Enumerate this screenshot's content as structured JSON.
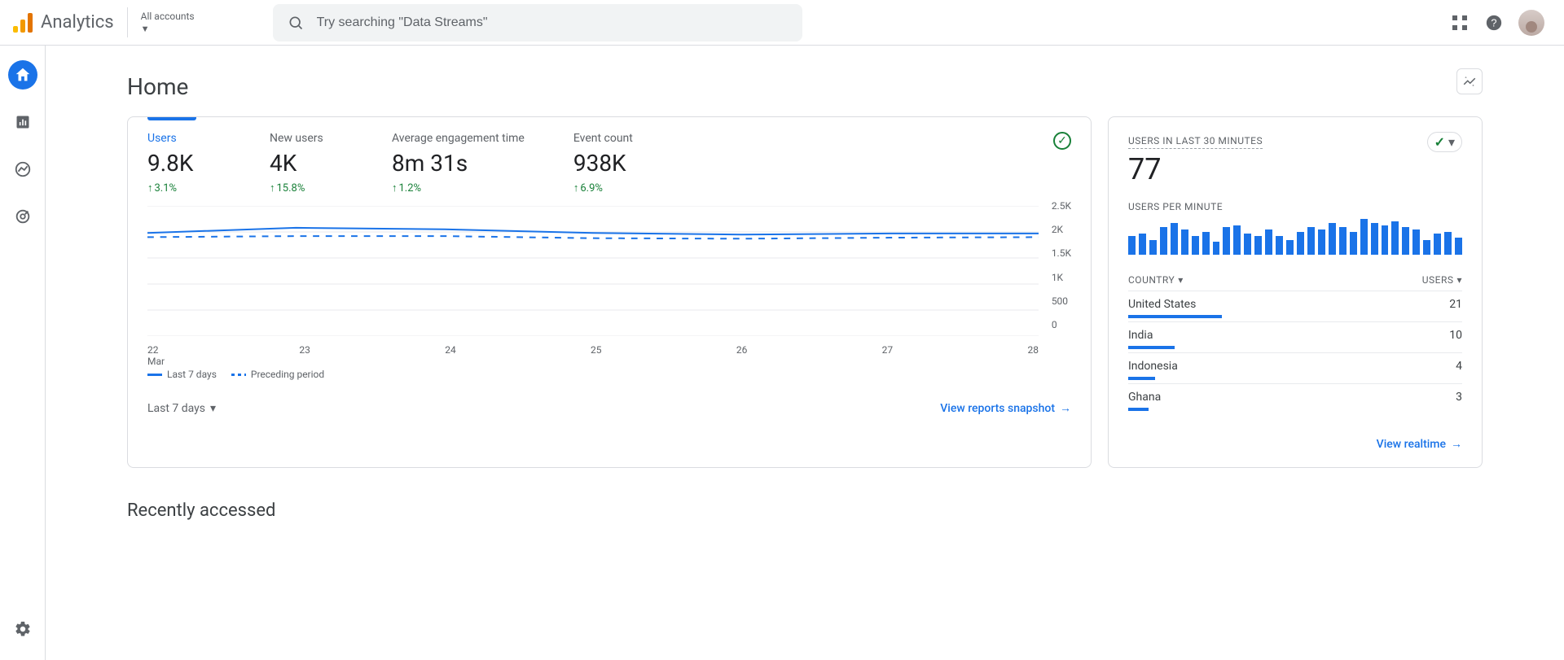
{
  "header": {
    "product_name": "Analytics",
    "account_switcher_label": "All accounts",
    "search_placeholder": "Try searching \"Data Streams\""
  },
  "page": {
    "title": "Home",
    "recently_accessed_title": "Recently accessed"
  },
  "main_card": {
    "metrics": [
      {
        "label": "Users",
        "value": "9.8K",
        "delta": "3.1%"
      },
      {
        "label": "New users",
        "value": "4K",
        "delta": "15.8%"
      },
      {
        "label": "Average engagement time",
        "value": "8m 31s",
        "delta": "1.2%"
      },
      {
        "label": "Event count",
        "value": "938K",
        "delta": "6.9%"
      }
    ],
    "y_ticks": [
      "2.5K",
      "2K",
      "1.5K",
      "1K",
      "500",
      "0"
    ],
    "x_ticks": [
      "22",
      "23",
      "24",
      "25",
      "26",
      "27",
      "28"
    ],
    "x_month": "Mar",
    "legend": {
      "current": "Last 7 days",
      "previous": "Preceding period"
    },
    "date_range_label": "Last 7 days",
    "footer_link": "View reports snapshot"
  },
  "chart_data": {
    "type": "line",
    "title": "Users",
    "xlabel": "",
    "ylabel": "",
    "ylim": [
      0,
      2500
    ],
    "categories": [
      "22",
      "23",
      "24",
      "25",
      "26",
      "27",
      "28"
    ],
    "series": [
      {
        "name": "Last 7 days",
        "values": [
          1980,
          2080,
          2050,
          1980,
          1950,
          1970,
          1970
        ]
      },
      {
        "name": "Preceding period",
        "values": [
          1900,
          1920,
          1920,
          1880,
          1870,
          1890,
          1900
        ]
      }
    ]
  },
  "realtime_card": {
    "title": "USERS IN LAST 30 MINUTES",
    "value": "77",
    "per_minute_label": "USERS PER MINUTE",
    "spark_values": [
      18,
      20,
      14,
      26,
      30,
      24,
      18,
      22,
      12,
      26,
      28,
      20,
      18,
      24,
      18,
      14,
      22,
      26,
      24,
      30,
      26,
      22,
      34,
      30,
      28,
      32,
      26,
      24,
      14,
      20,
      22,
      16
    ],
    "table": {
      "headers": {
        "left": "COUNTRY",
        "right": "USERS"
      },
      "rows": [
        {
          "country": "United States",
          "users": 21,
          "bar_pct": 28
        },
        {
          "country": "India",
          "users": 10,
          "bar_pct": 14
        },
        {
          "country": "Indonesia",
          "users": 4,
          "bar_pct": 8
        },
        {
          "country": "Ghana",
          "users": 3,
          "bar_pct": 6
        }
      ]
    },
    "footer_link": "View realtime"
  }
}
